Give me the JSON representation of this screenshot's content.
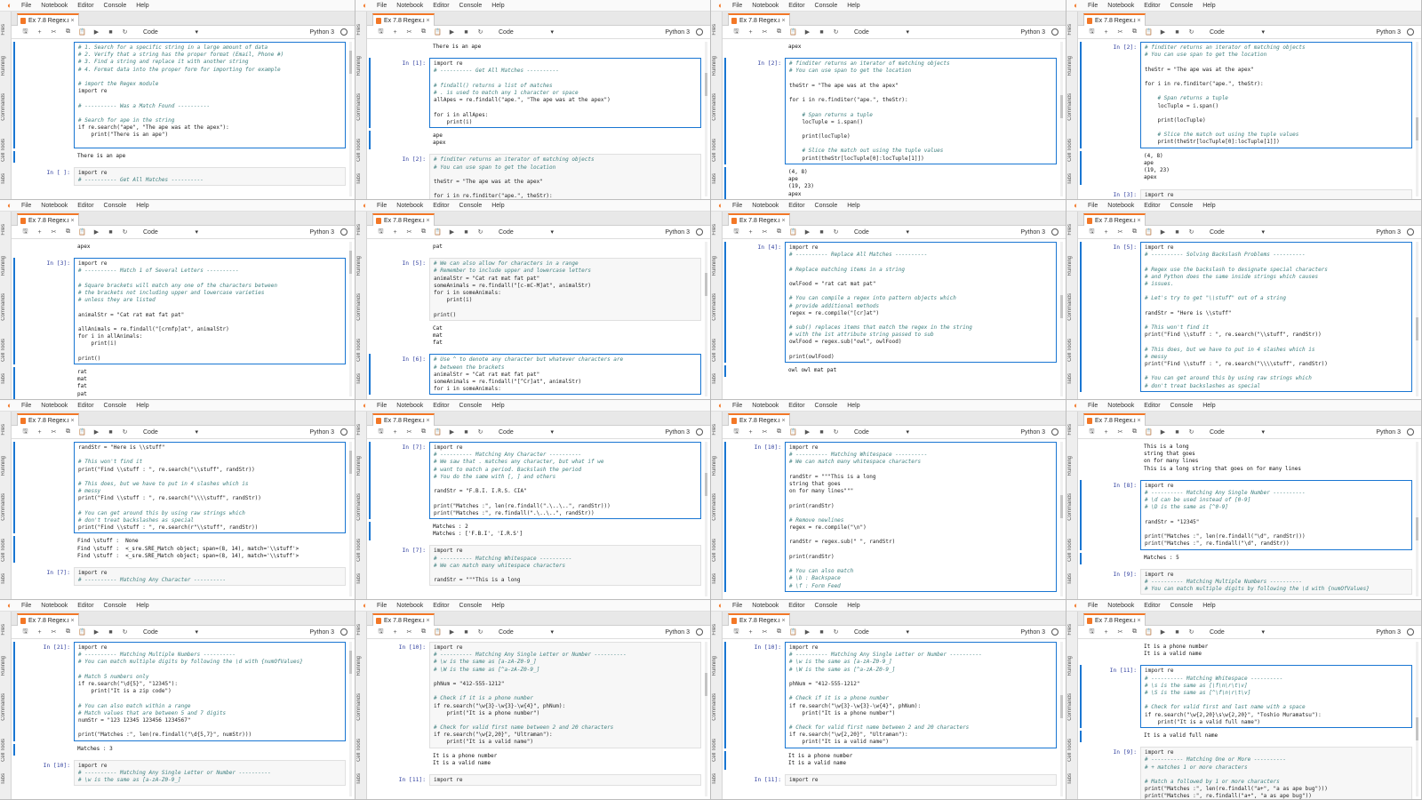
{
  "menubar": [
    "File",
    "Notebook",
    "Editor",
    "Console",
    "Help"
  ],
  "sidebar_tabs": [
    "Files",
    "Running",
    "Commands",
    "Cell Tools",
    "Tabs"
  ],
  "tab": {
    "label": "Ex 7.8 Regex.ip",
    "close": "×"
  },
  "toolbar": {
    "icons": [
      "save-icon",
      "add-icon",
      "cut-icon",
      "copy-icon",
      "paste-icon",
      "run-icon",
      "stop-icon",
      "restart-icon"
    ],
    "glyphs": [
      "🖫",
      "+",
      "✂",
      "⧉",
      "📋",
      "▶",
      "■",
      "↻"
    ],
    "celltype": "Code",
    "celltype_caret": "▾",
    "kernel": "Python 3"
  },
  "panels": [
    {
      "cells": [
        {
          "active": true,
          "prompt": "",
          "lines": [
            "# 1. Search for a specific string in a large amount of data",
            "# 2. Verify that a string has the proper format (Email, Phone #)",
            "# 3. Find a string and replace it with another string",
            "# 4. Format data into the proper form for importing for example",
            "",
            "# import the Regex module",
            "import re",
            "",
            "# ---------- Was a Match Found ----------",
            "",
            "# Search for ape in the string",
            "if re.search(\"ape\", \"The ape was at the apex\"):",
            "    print(\"There is an ape\")",
            ""
          ],
          "output": [
            "There is an ape"
          ]
        },
        {
          "active": false,
          "prompt": "In [ ]:",
          "lines": [
            "import re",
            "# ---------- Get All Matches ----------"
          ],
          "output": []
        }
      ]
    },
    {
      "cells": [
        {
          "active": false,
          "prompt": "",
          "lines": [],
          "output": [
            "There is an ape"
          ]
        },
        {
          "active": true,
          "prompt": "In [1]:",
          "lines": [
            "import re",
            "# ---------- Get All Matches ----------",
            "",
            "# findall() returns a list of matches",
            "# . is used to match any 1 character or space",
            "allApes = re.findall(\"ape.\", \"The ape was at the apex\")",
            "",
            "for i in allApes:",
            "    print(i)"
          ],
          "output": [
            "ape",
            "apex"
          ]
        },
        {
          "active": false,
          "prompt": "In [2]:",
          "lines": [
            "# finditer returns an iterator of matching objects",
            "# You can use span to get the location",
            "",
            "theStr = \"The ape was at the apex\"",
            "",
            "for i in re.finditer(\"ape.\", theStr):"
          ],
          "output": []
        }
      ]
    },
    {
      "cells": [
        {
          "active": false,
          "prompt": "",
          "lines": [],
          "output": [
            "apex"
          ]
        },
        {
          "active": true,
          "prompt": "In [2]:",
          "lines": [
            "# finditer returns an iterator of matching objects",
            "# You can use span to get the location",
            "",
            "theStr = \"The ape was at the apex\"",
            "",
            "for i in re.finditer(\"ape.\", theStr):",
            "",
            "    # Span returns a tuple",
            "    locTuple = i.span()",
            "",
            "    print(locTuple)",
            "",
            "    # Slice the match out using the tuple values",
            "    print(theStr[locTuple[0]:locTuple[1]])"
          ],
          "output": [
            "(4, 8)",
            "ape",
            "(19, 23)",
            "apex"
          ]
        }
      ]
    },
    {
      "cells": [
        {
          "active": true,
          "prompt": "In [2]:",
          "lines": [
            "# finditer returns an iterator of matching objects",
            "# You can use span to get the location",
            "",
            "theStr = \"The ape was at the apex\"",
            "",
            "for i in re.finditer(\"ape.\", theStr):",
            "",
            "    # Span returns a tuple",
            "    locTuple = i.span()",
            "",
            "    print(locTuple)",
            "",
            "    # Slice the match out using the tuple values",
            "    print(theStr[locTuple[0]:locTuple[1]])"
          ],
          "output": [
            "(4, 8)",
            "ape",
            "(19, 23)",
            "apex"
          ]
        },
        {
          "active": false,
          "prompt": "In [3]:",
          "lines": [
            "import re",
            "# ---------- Match 1 of Several Letters ----------"
          ],
          "output": []
        }
      ]
    },
    {
      "cells": [
        {
          "active": false,
          "prompt": "",
          "lines": [],
          "output": [
            "apex"
          ]
        },
        {
          "active": true,
          "prompt": "In [3]:",
          "lines": [
            "import re",
            "# ---------- Match 1 of Several Letters ----------",
            "",
            "# Square brackets will match any one of the characters between",
            "# the brackets not including upper and lowercase varieties",
            "# unless they are listed",
            "",
            "animalStr = \"Cat rat mat fat pat\"",
            "",
            "allAnimals = re.findall(\"[crmfp]at\", animalStr)",
            "for i in allAnimals:",
            "    print(i)",
            "",
            "print()"
          ],
          "output": [
            "rat",
            "mat",
            "fat",
            "pat"
          ]
        }
      ]
    },
    {
      "cells": [
        {
          "active": false,
          "prompt": "",
          "lines": [],
          "output": [
            "pat"
          ]
        },
        {
          "active": false,
          "prompt": "In [5]:",
          "lines": [
            "# We can also allow for characters in a range",
            "# Remember to include upper and lowercase letters",
            "animalStr = \"Cat rat mat fat pat\"",
            "someAnimals = re.findall(\"[c-mC-M]at\", animalStr)",
            "for i in someAnimals:",
            "    print(i)",
            "",
            "print()"
          ],
          "output": [
            "Cat",
            "mat",
            "fat"
          ]
        },
        {
          "active": true,
          "prompt": "In [6]:",
          "lines": [
            "# Use ^ to denote any character but whatever characters are",
            "# between the brackets",
            "animalStr = \"Cat rat mat fat pat\"",
            "someAnimals = re.findall(\"[^Cr]at\", animalStr)",
            "for i in someAnimals:"
          ],
          "output": []
        }
      ]
    },
    {
      "cells": [
        {
          "active": true,
          "prompt": "In [4]:",
          "lines": [
            "import re",
            "# ---------- Replace All Matches ----------",
            "",
            "# Replace matching items in a string",
            "",
            "owlFood = \"rat cat mat pat\"",
            "",
            "# You can compile a regex into pattern objects which",
            "# provide additional methods",
            "regex = re.compile(\"[cr]at\")",
            "",
            "# sub() replaces items that match the regex in the string",
            "# with the 1st attribute string passed to sub",
            "owlFood = regex.sub(\"owl\", owlFood)",
            "",
            "print(owlFood)"
          ],
          "output": [
            "owl owl mat pat"
          ]
        }
      ]
    },
    {
      "cells": [
        {
          "active": true,
          "prompt": "In [5]:",
          "lines": [
            "import re",
            "# ---------- Solving Backslash Problems ----------",
            "",
            "# Regex use the backslash to designate special characters",
            "# and Python does the same inside strings which causes",
            "# issues.",
            "",
            "# Let's try to get \"\\\\stuff\" out of a string",
            "",
            "randStr = \"Here is \\\\stuff\"",
            "",
            "# This won't find it",
            "print(\"Find \\\\stuff : \", re.search(\"\\\\stuff\", randStr))",
            "",
            "# This does, but we have to put in 4 slashes which is",
            "# messy",
            "print(\"Find \\\\stuff : \", re.search(\"\\\\\\\\stuff\", randStr))",
            "",
            "# You can get around this by using raw strings which",
            "# don't treat backslashes as special"
          ],
          "output": []
        }
      ]
    },
    {
      "cells": [
        {
          "active": true,
          "prompt": "",
          "lines": [
            "randStr = \"Here is \\\\stuff\"",
            "",
            "# This won't find it",
            "print(\"Find \\\\stuff : \", re.search(\"\\\\stuff\", randStr))",
            "",
            "# This does, but we have to put in 4 slashes which is",
            "# messy",
            "print(\"Find \\\\stuff : \", re.search(\"\\\\\\\\stuff\", randStr))",
            "",
            "# You can get around this by using raw strings which",
            "# don't treat backslashes as special",
            "print(\"Find \\\\stuff : \", re.search(r\"\\\\stuff\", randStr))"
          ],
          "output": [
            "Find \\stuff :  None",
            "Find \\stuff :  <_sre.SRE_Match object; span=(8, 14), match='\\\\stuff'>",
            "Find \\stuff :  <_sre.SRE_Match object; span=(8, 14), match='\\\\stuff'>"
          ]
        },
        {
          "active": false,
          "prompt": "In [7]:",
          "lines": [
            "import re",
            "# ---------- Matching Any Character ----------"
          ],
          "output": []
        }
      ]
    },
    {
      "cells": [
        {
          "active": true,
          "prompt": "In [7]:",
          "lines": [
            "import re",
            "# ---------- Matching Any Character ----------",
            "# We saw that . matches any character, but what if we",
            "# want to match a period. Backslash the period",
            "# You do the same with [, ] and others",
            "",
            "randStr = \"F.B.I. I.R.S. CIA\"",
            "",
            "print(\"Matches :\", len(re.findall(\".\\..\\..\", randStr)))",
            "print(\"Matches :\", re.findall(\".\\..\\..\", randStr))"
          ],
          "output": [
            "Matches : 2",
            "Matches : ['F.B.I', 'I.R.S']"
          ]
        },
        {
          "active": false,
          "prompt": "In [7]:",
          "lines": [
            "import re",
            "# ---------- Matching Whitespace ----------",
            "# We can match many whitespace characters",
            "",
            "randStr = \"\"\"This is a long"
          ],
          "output": []
        }
      ]
    },
    {
      "cells": [
        {
          "active": true,
          "prompt": "In [10]:",
          "lines": [
            "import re",
            "# ---------- Matching Whitespace ----------",
            "# We can match many whitespace characters",
            "",
            "randStr = \"\"\"This is a long",
            "string that goes",
            "on for many lines\"\"\"",
            "",
            "print(randStr)",
            "",
            "# Remove newlines",
            "regex = re.compile(\"\\n\")",
            "",
            "randStr = regex.sub(\" \", randStr)",
            "",
            "print(randStr)",
            "",
            "# You can also match",
            "# \\b : Backspace",
            "# \\f : Form Feed"
          ],
          "output": []
        }
      ]
    },
    {
      "cells": [
        {
          "active": false,
          "prompt": "",
          "lines": [],
          "output": [
            "This is a long",
            "string that goes",
            "on for many lines",
            "This is a long string that goes on for many lines"
          ]
        },
        {
          "active": true,
          "prompt": "In [8]:",
          "lines": [
            "import re",
            "# ---------- Matching Any Single Number ----------",
            "# \\d can be used instead of [0-9]",
            "# \\D is the same as [^0-9]",
            "",
            "randStr = \"12345\"",
            "",
            "print(\"Matches :\", len(re.findall(\"\\d\", randStr)))",
            "print(\"Matches :\", re.findall(\"\\d\", randStr))"
          ],
          "output": [
            "Matches : 5"
          ]
        },
        {
          "active": false,
          "prompt": "In [9]:",
          "lines": [
            "import re",
            "# ---------- Matching Multiple Numbers ----------",
            "# You can match multiple digits by following the \\d with {numOfValues}"
          ],
          "output": []
        }
      ]
    },
    {
      "cells": [
        {
          "active": true,
          "prompt": "In [21]:",
          "lines": [
            "import re",
            "# ---------- Matching Multiple Numbers ----------",
            "# You can match multiple digits by following the \\d with {numOfValues}",
            "",
            "# Match 5 numbers only",
            "if re.search(\"\\d{5}\", \"12345\"):",
            "    print(\"It is a zip code\")",
            "",
            "# You can also match within a range",
            "# Match values that are between 5 and 7 digits",
            "numStr = \"123 12345 123456 1234567\"",
            "",
            "print(\"Matches :\", len(re.findall(\"\\d{5,7}\", numStr)))"
          ],
          "output": [
            "Matches : 3"
          ]
        },
        {
          "active": false,
          "prompt": "In [10]:",
          "lines": [
            "import re",
            "# ---------- Matching Any Single Letter or Number ----------",
            "# \\w is the same as [a-zA-Z0-9_]"
          ],
          "output": []
        }
      ]
    },
    {
      "cells": [
        {
          "active": false,
          "prompt": "In [10]:",
          "lines": [
            "import re",
            "# ---------- Matching Any Single Letter or Number ----------",
            "# \\w is the same as [a-zA-Z0-9_]",
            "# \\W is the same as [^a-zA-Z0-9_]",
            "",
            "phNum = \"412-555-1212\"",
            "",
            "# Check if it is a phone number",
            "if re.search(\"\\w{3}-\\w{3}-\\w{4}\", phNum):",
            "    print(\"It is a phone number\")",
            "",
            "# Check for valid first name between 2 and 20 characters",
            "if re.search(\"\\w{2,20}\", \"Ultraman\"):",
            "    print(\"It is a valid name\")"
          ],
          "output": [
            "It is a phone number",
            "It is a valid name"
          ]
        },
        {
          "active": false,
          "prompt": "In [11]:",
          "lines": [
            "import re"
          ],
          "output": []
        }
      ]
    },
    {
      "cells": [
        {
          "active": true,
          "prompt": "In [10]:",
          "lines": [
            "import re",
            "# ---------- Matching Any Single Letter or Number ----------",
            "# \\w is the same as [a-zA-Z0-9_]",
            "# \\W is the same as [^a-zA-Z0-9_]",
            "",
            "phNum = \"412-555-1212\"",
            "",
            "# Check if it is a phone number",
            "if re.search(\"\\w{3}-\\w{3}-\\w{4}\", phNum):",
            "    print(\"It is a phone number\")",
            "",
            "# Check for valid first name between 2 and 20 characters",
            "if re.search(\"\\w{2,20}\", \"Ultraman\"):",
            "    print(\"It is a valid name\")"
          ],
          "output": [
            "It is a phone number",
            "It is a valid name"
          ]
        },
        {
          "active": false,
          "prompt": "In [11]:",
          "lines": [
            "import re"
          ],
          "output": []
        }
      ]
    },
    {
      "cells": [
        {
          "active": false,
          "prompt": "",
          "lines": [],
          "output": [
            "It is a phone number",
            "It is a valid name"
          ]
        },
        {
          "active": true,
          "prompt": "In [11]:",
          "lines": [
            "import re",
            "# ---------- Matching Whitespace ----------",
            "# \\s is the same as [\\f\\n\\r\\t\\v]",
            "# \\S is the same as [^\\f\\n\\r\\t\\v]",
            "",
            "# Check for valid first and last name with a space",
            "if re.search(\"\\w{2,20}\\s\\w{2,20}\", \"Toshio Muramatsu\"):",
            "    print(\"It is a valid full name\")"
          ],
          "output": [
            "It is a valid full name"
          ]
        },
        {
          "active": false,
          "prompt": "In [9]:",
          "lines": [
            "import re",
            "# ---------- Matching One or More ----------",
            "# + matches 1 or more characters",
            "",
            "# Match a followed by 1 or more characters",
            "print(\"Matches :\", len(re.findall(\"a+\", \"a as ape bug\")))",
            "print(\"Matches :\", re.findall(\"a+\", \"a as ape bug\"))"
          ],
          "output": []
        }
      ]
    }
  ]
}
